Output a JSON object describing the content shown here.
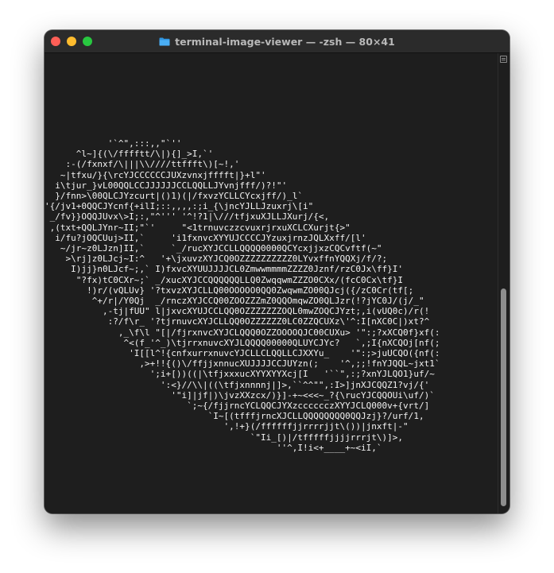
{
  "window": {
    "title": "terminal-image-viewer — -zsh — 80×41",
    "icon": "folder-icon",
    "traffic_lights": {
      "close_color": "#ff5f57",
      "minimize_color": "#febc2e",
      "maximize_color": "#28c840"
    }
  },
  "terminal": {
    "background": "#1e1e1e",
    "foreground": "#f2f2f2",
    "ascii_art": "            '`^\",:::,,\"`''\n      ^l~]{(\\/fffftt/\\|){]_>I,`'\n    :-(/fxnxf/\\|||\\\\////ttffft\\)[~!,'\n   ~|tfxu/}{\\rcYJCCCCCCJUXzvnxjfffft|}+l\"'\n  i\\tjur_}vL00QQLCCJJJJJJCCLQQLLJYvnjfff/)?!\"'\n  }/fnn>\\00QLCJYzcurt|()1)(|/fxvzYCLLCYcxjff/)_l`\n'{/jv1+0QQCJYcnf{+ilI;::,,,,:;i_{\\jncYJLLJzuxrj\\[i\"\n _/fv}}OQQJUvx\\>I;:,\"^''' '^!?1|\\///tfjxuXJLLJXurj/{<,\n ,(txt+QQLJYnr~II;\"`'     \"<1trnuvczzcvuxrjrxuXCLCXurjt{>\"\n  i/fu?jOQCUuj>II,`     'i1fxnvcXYYUJCCCCJYzuxjrnzJQLXxff/[l'\n   ~/jr~z0LJzn]II,`     `_/rucXYJCCLLQQQQ0000QCYcxjjxzCQCvftf(~\"\n    >\\rj]z0LJcj~I:^   '+\\jxuvzXYJCQ0OZZZZZZZZZZ0LYvxffnYQQXj/f/?;\n     I)jj}n0LJcf~;,` I)fxvcXYUUJJJJCL0ZmwwmmmmZZZZ0Jznf/rzC0Jx\\ff}I'\n      \"?fx)tC0CXr~;` _/xucXYJCCQQQQQQLLQ0ZwqqwmZZZO0CXx/(fcC0Cx\\tf}I\n        !)r/(vQLUv} '?txvzXYJCLLQ00OOOOO0QQ0ZwqwmZO00QJcj({/zC0Cr(tf[;\n         ^+/r|/Y0Qj  _/rnczXYJCCQ00ZOOZZZmZ0QQOmqwZO0QLJzr(!?jYC0J/(j/_\"\n           ,-tj|fUU\" l|jxvcXYUJCCLQQ0OZZZZZZZOQL0mwZOQCJYzt;,i(vUQ0c)/r(!\n            :?/f\\r_ '?tjrnuvcXYJCLLQQ0OZZZZZZ0LC0ZZQCUXz\\'^:I[nXC0C|)xt?^\n              ,_\\f\\l \"[|/fjrxnvcXYJCLQQQ0OZZOOOOQJC00CUXu> '\":;?xXCQ0f}xf(:\n               ^<(f_'^_)\\tjrrxnuvcXYJLQQQQ00000QLUYCJYc?   `,;I{nXCQOj[nf(;\n                'I[[l^!{cnfxurrxnuvcYJCLLCLQQLLCJXXYu_    '\":;>juUCQO({nf(:\n                  ,>+!!{()\\/ffjjxnnucXUJJJJCCJUYzn(;    '^,;;!fnYJQQL~jxt1`\n                    ';i+[))((|\\tfjxxxucXYYXYYXcj[I   '``\",:;?xnYJLQO1}uf/~\n                      ':<}//\\\\|((\\tfjxnnnnj|]>,``^^\"\",:I>]jnXJCQQZ1?vj/{'\n                        '\"i]|jf|)\\jvzXXzcx/)}]-+~<<<~_?{\\rucYJCQQOUi\\uf/)`\n                           `;~{/fjjrncYCLQQCJYXzcccccczXYYJCLQ000v+{vrt/]\n                               `I~[(tfffjrncXJCLLQQQQQQQQ0QQJzj}?/urf/1,\n                                  ',!+}(/ffffffjjrrrrjjt\\())|jnxft|-\"\n                                       `\"Ii_[)|/tfffffjjjjrrrjt\\)]>,\n                                            ''^,I!i<+____+~<iI,`"
  },
  "scrollbar": {
    "position_fraction": 0.78
  }
}
